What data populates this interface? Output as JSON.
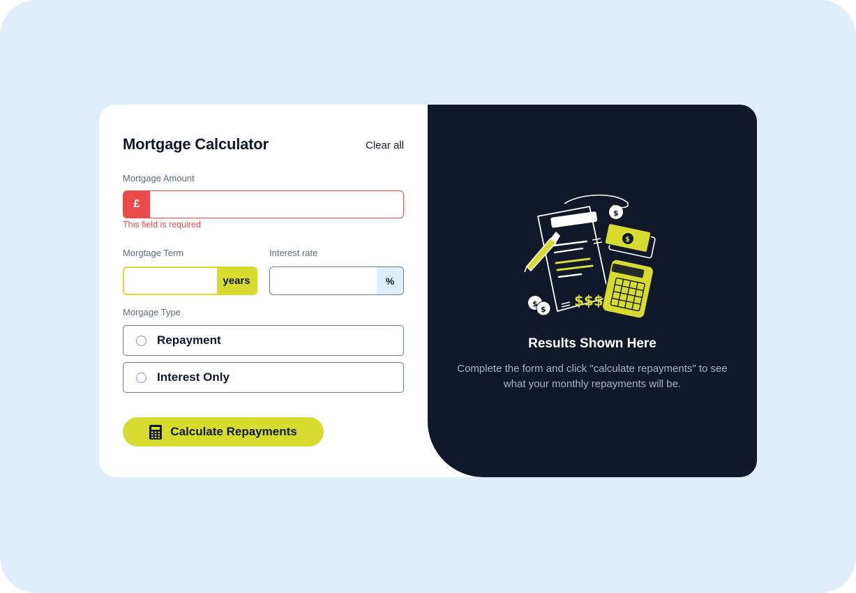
{
  "form": {
    "title": "Mortgage Calculator",
    "clear_all": "Clear all",
    "amount": {
      "label": "Mortgage Amount",
      "prefix": "£",
      "value": "",
      "error": "This field is required"
    },
    "term": {
      "label": "Morgtage Term",
      "suffix": "years",
      "value": ""
    },
    "rate": {
      "label": "Interest rate",
      "suffix": "%",
      "value": ""
    },
    "type": {
      "label": "Morgage Type",
      "options": [
        "Repayment",
        "Interest Only"
      ]
    },
    "submit": "Calculate Repayments"
  },
  "results": {
    "title": "Results Shown Here",
    "description": "Complete the form and click \"calculate repayments\" to see what your monthly repayments will be."
  },
  "colors": {
    "lime": "#d7da2f",
    "navy": "#10182a",
    "error": "#e94b4b",
    "background": "#e0eefb"
  },
  "icons": {
    "button": "calculator-icon",
    "illustration": "empty-results-illustration"
  }
}
